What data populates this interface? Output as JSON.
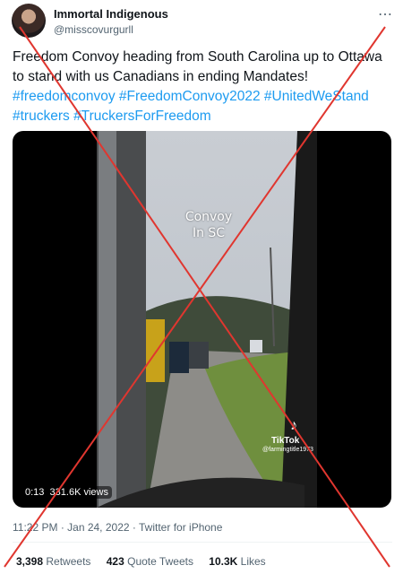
{
  "author": {
    "display_name": "Immortal Indigenous",
    "handle": "@misscovurgurll"
  },
  "more_icon": "more-dots-icon",
  "tweet": {
    "text": "Freedom Convoy heading from South Carolina up to Ottawa to stand with us Canadians in ending Mandates!",
    "hashtags": [
      "#freedomconvoy",
      "#FreedomConvoy2022",
      "#UnitedWeStand",
      "#truckers",
      "#TruckersForFreedom"
    ]
  },
  "video": {
    "overlay_line1": "Convoy",
    "overlay_line2": "In SC",
    "tiktok_label": "TikTok",
    "tiktok_handle": "@farmingtitle1973",
    "time": "0:13",
    "views": "331.6K views"
  },
  "meta": {
    "time": "11:22 PM",
    "date": "Jan 24, 2022",
    "source": "Twitter for iPhone"
  },
  "stats": {
    "retweets_count": "3,398",
    "retweets_label": "Retweets",
    "quotes_count": "423",
    "quotes_label": "Quote Tweets",
    "likes_count": "10.3K",
    "likes_label": "Likes"
  },
  "colors": {
    "link": "#1d9bf0",
    "stamp_cross": "#e0362f",
    "secondary_text": "#536471"
  }
}
